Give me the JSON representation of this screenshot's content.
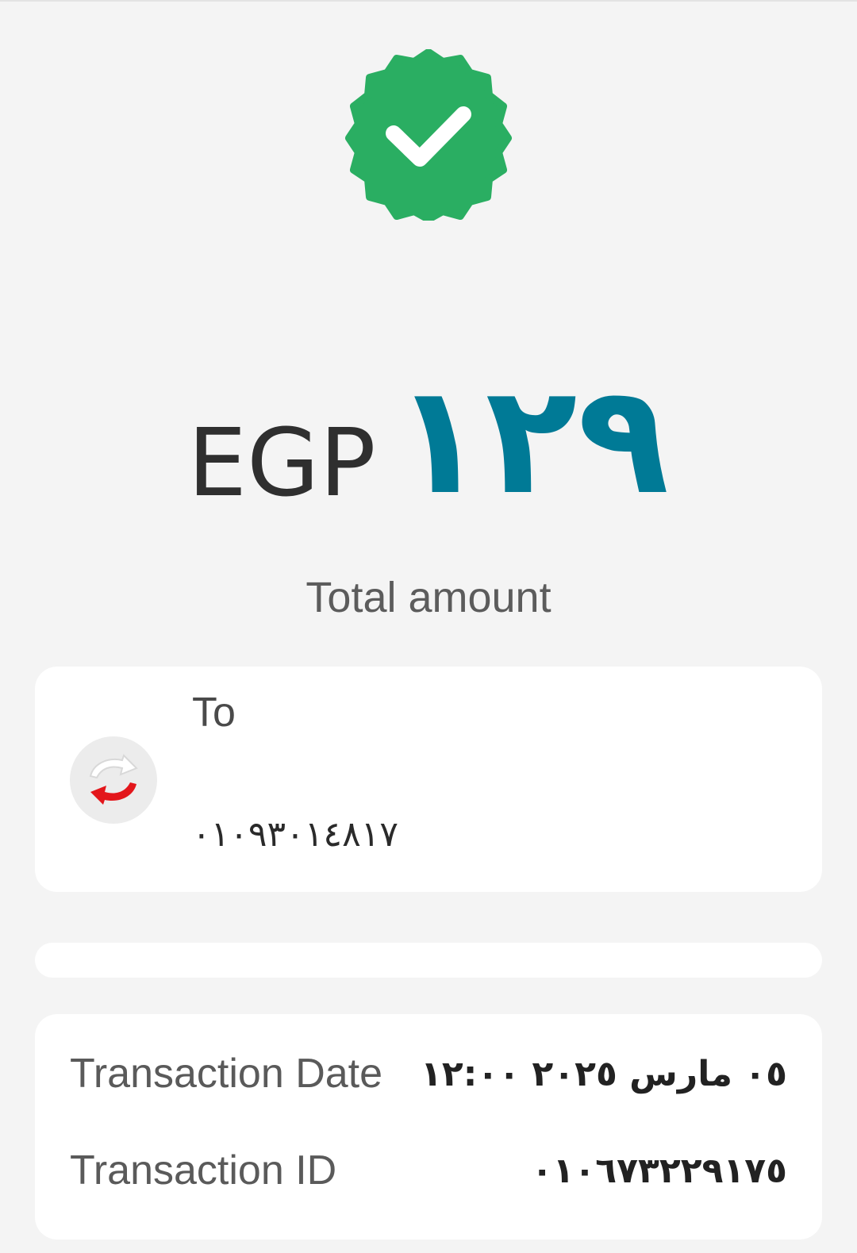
{
  "status": {
    "icon": "verified-check-badge-icon",
    "color": "#2aae62"
  },
  "amount": {
    "currency": "EGP",
    "value": "١٢٩",
    "color": "#007a96",
    "label": "Total amount"
  },
  "recipient": {
    "label": "To",
    "avatar_icon": "refresh-arrows-icon",
    "number": "٠١٠٩٣٠١٤٨١٧"
  },
  "details": {
    "date_label": "Transaction Date",
    "date_value": "٠٥ مارس ٢٠٢٥  ١٢:٠٠",
    "id_label": "Transaction ID",
    "id_value": "٠١٠٦٧٣٢٢٩١٧٥"
  }
}
